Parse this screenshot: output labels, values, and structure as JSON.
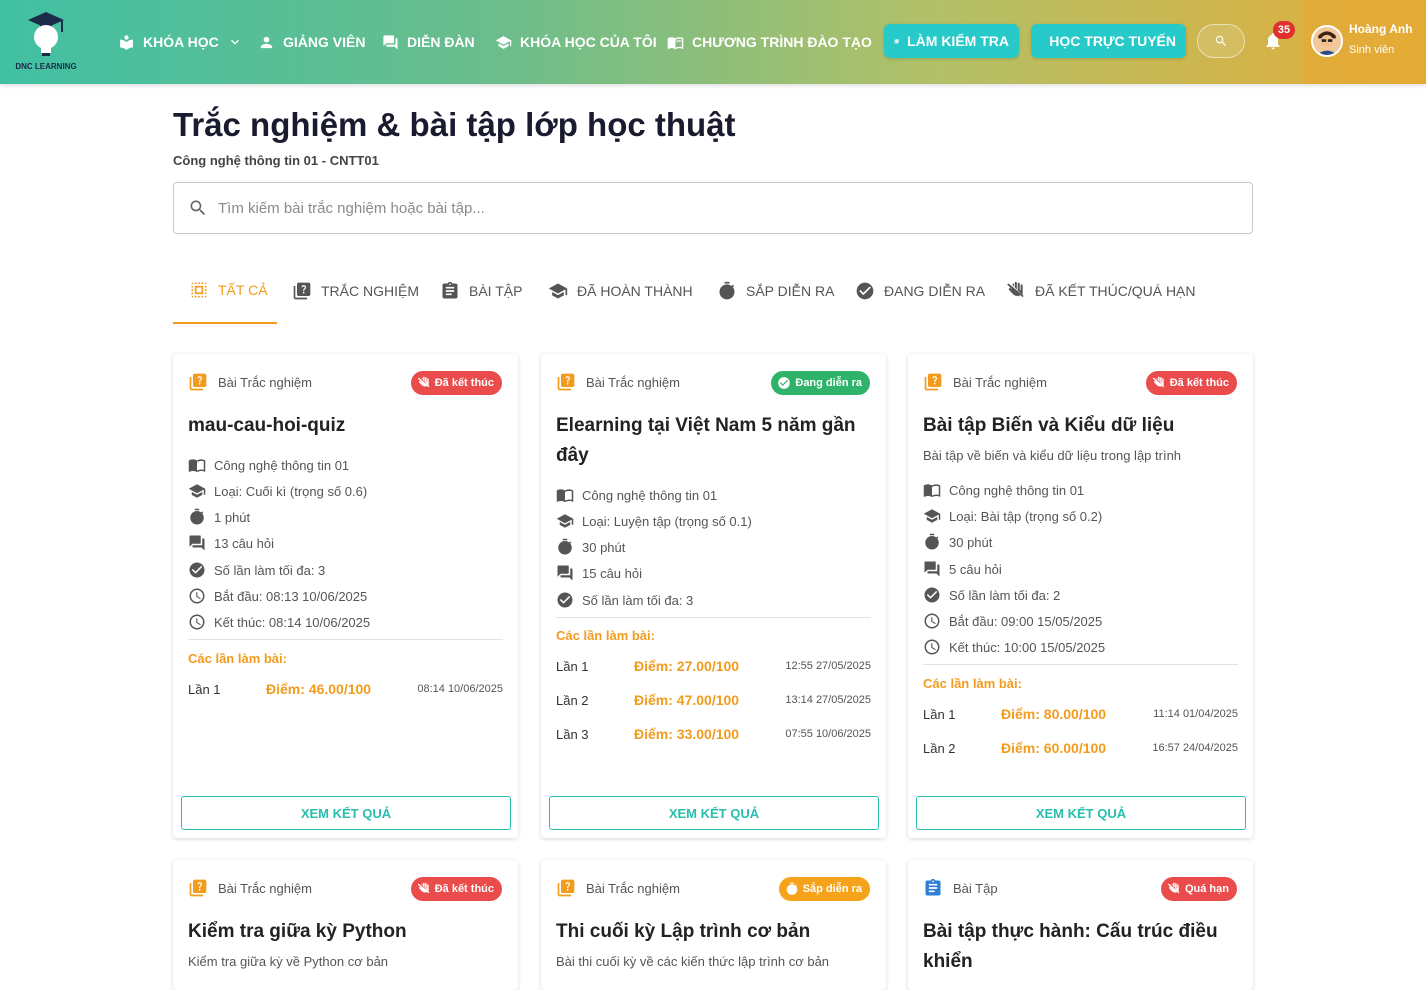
{
  "brand": {
    "logo_text": "DNC LEARNING"
  },
  "nav": {
    "courses": "KHÓA HỌC",
    "teachers": "GIẢNG VIÊN",
    "forum": "DIỄN ĐÀN",
    "my_courses": "KHÓA HỌC CỦA TÔI",
    "programs": "CHƯƠNG TRÌNH ĐÀO TẠO"
  },
  "actions": {
    "take_test": "LÀM KIỂM TRA",
    "online_class": "HỌC TRỰC TUYẾN"
  },
  "notifications": {
    "count": "35"
  },
  "user": {
    "name": "Hoàng Anh",
    "role": "Sinh viên"
  },
  "page": {
    "title": "Trắc nghiệm & bài tập lớp học thuật",
    "subtitle": "Công nghệ thông tin 01 - CNTT01"
  },
  "search": {
    "placeholder": "Tìm kiếm bài trắc nghiệm hoặc bài tập..."
  },
  "tabs": [
    {
      "label": "TẤT CẢ",
      "icon": "select-all-icon"
    },
    {
      "label": "TRẮC NGHIỆM",
      "icon": "quiz-icon"
    },
    {
      "label": "BÀI TẬP",
      "icon": "assignment-icon"
    },
    {
      "label": "ĐÃ HOÀN THÀNH",
      "icon": "graduation-cap-icon"
    },
    {
      "label": "SẮP DIỄN RA",
      "icon": "timer-icon"
    },
    {
      "label": "ĐANG DIỄN RA",
      "icon": "check-circle-icon"
    },
    {
      "label": "ĐÃ KẾT THÚC/QUÁ HẠN",
      "icon": "do-not-touch-icon"
    }
  ],
  "cards": [
    {
      "type": "Bài Trắc nghiệm",
      "status": "Đã kết thúc",
      "title": "mau-cau-hoi-quiz",
      "meta": {
        "course": "Công nghệ thông tin 01",
        "kind": "Loại: Cuối kì (trọng số 0.6)",
        "duration": "1 phút",
        "questions": "13 câu hỏi",
        "max_attempts": "Số lần làm tối đa: 3",
        "start": "Bắt đầu: 08:13 10/06/2025",
        "end": "Kết thúc: 08:14 10/06/2025"
      },
      "attempts_title": "Các lần làm bài:",
      "attempts": [
        {
          "label": "Lần 1",
          "score": "Điểm: 46.00/100",
          "time": "08:14 10/06/2025"
        }
      ],
      "button": "XEM KẾT QUẢ"
    },
    {
      "type": "Bài Trắc nghiệm",
      "status": "Đang diễn ra",
      "title": "Elearning tại Việt Nam 5 năm gần đây",
      "meta": {
        "course": "Công nghệ thông tin 01",
        "kind": "Loại: Luyện tập (trọng số 0.1)",
        "duration": "30 phút",
        "questions": "15 câu hỏi",
        "max_attempts": "Số lần làm tối đa: 3"
      },
      "attempts_title": "Các lần làm bài:",
      "attempts": [
        {
          "label": "Lần 1",
          "score": "Điểm: 27.00/100",
          "time": "12:55 27/05/2025"
        },
        {
          "label": "Lần 2",
          "score": "Điểm: 47.00/100",
          "time": "13:14 27/05/2025"
        },
        {
          "label": "Lần 3",
          "score": "Điểm: 33.00/100",
          "time": "07:55 10/06/2025"
        }
      ],
      "button": "XEM KẾT QUẢ"
    },
    {
      "type": "Bài Trắc nghiệm",
      "status": "Đã kết thúc",
      "title": "Bài tập Biến và Kiểu dữ liệu",
      "description": "Bài tập về biến và kiểu dữ liệu trong lập trình",
      "meta": {
        "course": "Công nghệ thông tin 01",
        "kind": "Loại: Bài tập (trọng số 0.2)",
        "duration": "30 phút",
        "questions": "5 câu hỏi",
        "max_attempts": "Số lần làm tối đa: 2",
        "start": "Bắt đầu: 09:00 15/05/2025",
        "end": "Kết thúc: 10:00 15/05/2025"
      },
      "attempts_title": "Các lần làm bài:",
      "attempts": [
        {
          "label": "Lần 1",
          "score": "Điểm: 80.00/100",
          "time": "11:14 01/04/2025"
        },
        {
          "label": "Lần 2",
          "score": "Điểm: 60.00/100",
          "time": "16:57 24/04/2025"
        }
      ],
      "button": "XEM KẾT QUẢ"
    },
    {
      "type": "Bài Trắc nghiệm",
      "status": "Đã kết thúc",
      "title": "Kiểm tra giữa kỳ Python",
      "description": "Kiểm tra giữa kỳ về Python cơ bản"
    },
    {
      "type": "Bài Trắc nghiệm",
      "status": "Sắp diễn ra",
      "title": "Thi cuối kỳ Lập trình cơ bản",
      "description": "Bài thi cuối kỳ về các kiến thức lập trình cơ bản"
    },
    {
      "type": "Bài Tập",
      "status": "Quá hạn",
      "title": "Bài tập thực hành: Cấu trúc điều khiển"
    }
  ],
  "colors": {
    "accent": "#f29b1d",
    "teal": "#28bfae",
    "red_badge": "#ea4c4c",
    "green_badge": "#2fb36b",
    "orange_badge": "#f7a21b"
  }
}
